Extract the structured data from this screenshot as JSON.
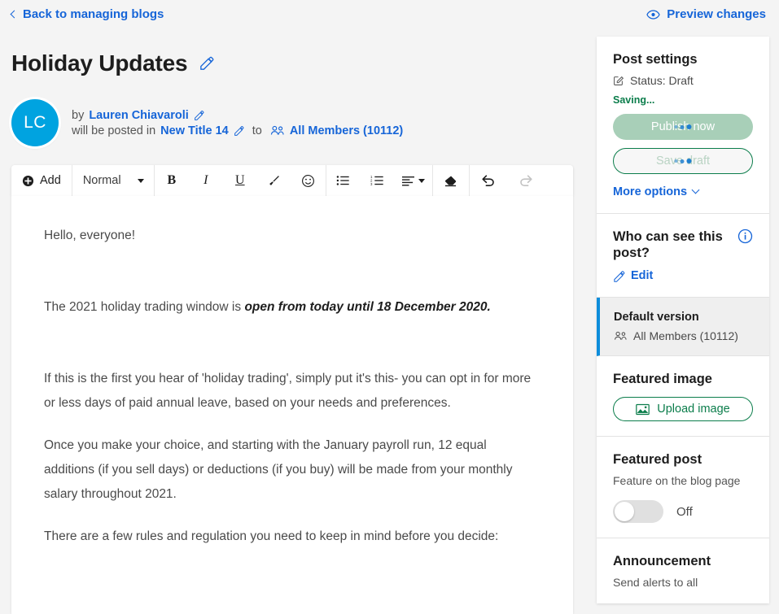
{
  "topbar": {
    "back_label": "Back to managing blogs",
    "back_icon": "chevron-left-icon",
    "preview_label": "Preview changes",
    "preview_icon": "eye-icon"
  },
  "header": {
    "post_title": "Holiday Updates",
    "title_edit_icon": "pencil-icon",
    "avatar_initials": "LC",
    "avatar_color": "#00a3e0",
    "by_prefix": "by",
    "author_name": "Lauren Chiavaroli",
    "author_edit_icon": "pencil-icon",
    "posted_prefix": "will be posted in",
    "blog_name": "New Title 14",
    "blog_edit_icon": "pencil-icon",
    "to_label": "to",
    "audience_icon": "people-icon",
    "audience": "All Members (10112)"
  },
  "toolbar": {
    "add_label": "Add",
    "add_icon": "plus-circle-icon",
    "style_value": "Normal",
    "style_caret_icon": "caret-down-icon",
    "buttons": [
      {
        "name": "bold-button",
        "glyph": "B",
        "icon": "bold-icon"
      },
      {
        "name": "italic-button",
        "glyph": "I",
        "icon": "italic-icon"
      },
      {
        "name": "underline-button",
        "glyph": "U",
        "icon": "underline-icon"
      },
      {
        "name": "text-color-button",
        "glyph": "",
        "icon": "brush-icon"
      },
      {
        "name": "emoji-button",
        "glyph": "",
        "icon": "smiley-icon"
      },
      {
        "name": "bullet-list-button",
        "glyph": "",
        "icon": "bullet-list-icon"
      },
      {
        "name": "numbered-list-button",
        "glyph": "",
        "icon": "numbered-list-icon"
      },
      {
        "name": "align-button",
        "glyph": "",
        "icon": "align-left-icon"
      },
      {
        "name": "clear-format-button",
        "glyph": "",
        "icon": "eraser-icon"
      },
      {
        "name": "undo-button",
        "glyph": "",
        "icon": "undo-icon"
      },
      {
        "name": "redo-button",
        "glyph": "",
        "icon": "redo-icon"
      }
    ]
  },
  "editor": {
    "paragraphs": [
      {
        "text": "Hello, everyone!",
        "spaced": true
      },
      {
        "text": "The 2021 holiday trading window is ",
        "bold_tail": "open from today until 18 December 2020.",
        "spaced": true
      },
      {
        "text": "If this is the first you hear of 'holiday trading', simply put it's this- you can opt in for more or less days of paid annual leave, based on your needs and preferences.",
        "spaced": false
      },
      {
        "text": "Once you make your choice, and starting with the January payroll run, 12 equal additions (if you sell days) or deductions (if you buy) will be made from your monthly salary throughout 2021.",
        "spaced": false
      },
      {
        "text": "There are a few rules and regulation you need to keep in mind before you decide:",
        "spaced": false
      }
    ]
  },
  "sidebar": {
    "post_settings": {
      "title": "Post settings",
      "status_icon": "edit-square-icon",
      "status_text": "Status: Draft",
      "saving_text": "Saving...",
      "saving_color": "#0b7d4b",
      "publish_label": "Publish now",
      "save_draft_label": "Save draft",
      "more_options_label": "More options",
      "more_options_icon": "chevron-down-icon"
    },
    "visibility": {
      "title": "Who can see this post?",
      "info_icon": "info-circle-icon",
      "edit_label": "Edit",
      "edit_icon": "pencil-icon"
    },
    "version": {
      "title": "Default version",
      "audience_icon": "people-icon",
      "audience": "All Members (10112)",
      "accent_color": "#0d8ddb"
    },
    "featured_image": {
      "title": "Featured image",
      "upload_label": "Upload image",
      "upload_icon": "image-icon",
      "accent_color": "#0b7d4b"
    },
    "featured_post": {
      "title": "Featured post",
      "subtitle": "Feature on the blog page",
      "toggle_state": "Off"
    },
    "announcement": {
      "title": "Announcement",
      "subtitle": "Send alerts to all"
    }
  }
}
